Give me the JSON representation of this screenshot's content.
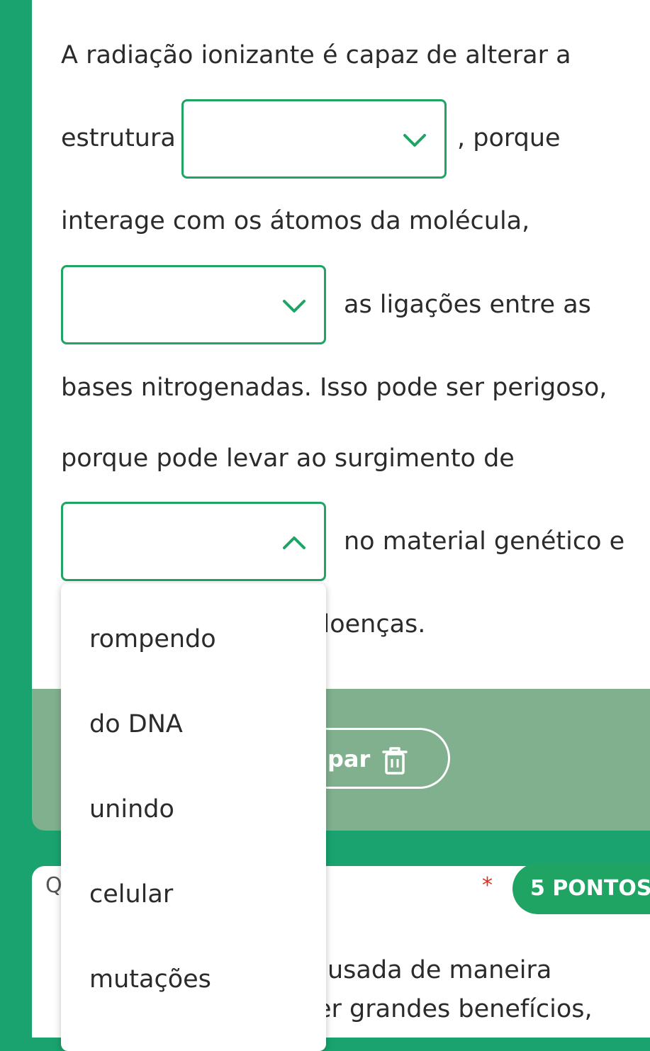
{
  "question1": {
    "line1": "A radiação ionizante é capaz de alterar a",
    "line2_before": "estrutura",
    "line2_after": ", porque",
    "line3": "interage com os átomos da molécula,",
    "line4_after": "as ligações entre as",
    "line5": "bases nitrogenadas. Isso pode ser perigoso,",
    "line6": "porque pode levar ao surgimento de",
    "line7_after": "no material genético e",
    "line8_partial": "doenças.",
    "dropdown1_value": "",
    "dropdown2_value": "",
    "dropdown3_value": ""
  },
  "dropdown_menu": {
    "options": [
      "rompendo",
      "do DNA",
      "unindo",
      "celular",
      "mutações"
    ]
  },
  "footer": {
    "clear_label_partial": "par"
  },
  "question2": {
    "number_partial": "Q",
    "required_mark": "*",
    "points": "5 PONTOS",
    "line1_partial": "usada de maneira",
    "line2_partial": "er grandes benefícios,"
  },
  "colors": {
    "accent_green": "#1fa463",
    "page_background": "#1aa36f",
    "footer_background": "#80b08e"
  },
  "icons": {
    "dropdown_closed": "chevron-down-icon",
    "dropdown_open": "chevron-up-icon",
    "clear": "trash-icon"
  }
}
